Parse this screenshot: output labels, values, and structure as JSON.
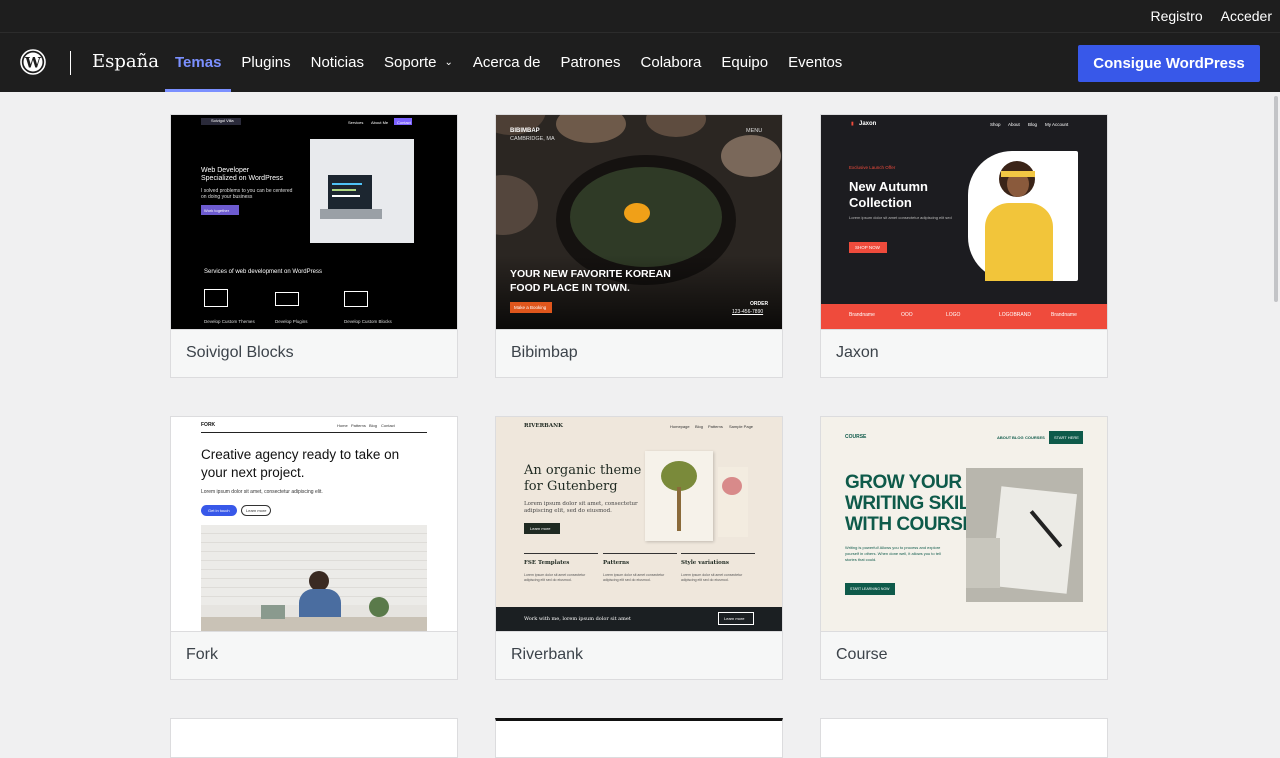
{
  "topbar": {
    "register": "Registro",
    "login": "Acceder"
  },
  "nav": {
    "locale": "España",
    "items": [
      "Temas",
      "Plugins",
      "Noticias",
      "Soporte",
      "Acerca de",
      "Patrones",
      "Colabora",
      "Equipo",
      "Eventos"
    ],
    "cta": "Consigue WordPress"
  },
  "themes": [
    {
      "name": "Soivigol Blocks",
      "preview": {
        "logo": "Soivigol Villa",
        "nav": [
          "Services",
          "About Me",
          "Contact"
        ],
        "headline1": "Web Developer",
        "headline2": "Specialized on WordPress",
        "text1": "I solved problems to you can be centered",
        "text2": "on doing your business",
        "button": "Work together",
        "section": "Services of web development on WordPress",
        "services": [
          "Develop Custom Themes",
          "Develop Plugins",
          "Develop Custom Blocks"
        ]
      }
    },
    {
      "name": "Bibimbap",
      "preview": {
        "brand": "BIBIMBAP",
        "city": "CAMBRIDGE, MA",
        "menu": "MENU",
        "headline1": "YOUR NEW FAVORITE KOREAN",
        "headline2": "FOOD PLACE IN TOWN.",
        "button": "Make a Booking",
        "order": "ORDER",
        "phone": "123-456-7890"
      }
    },
    {
      "name": "Jaxon",
      "preview": {
        "logo": "Jaxon",
        "nav": [
          "Shop",
          "About",
          "Blog",
          "My Account"
        ],
        "kicker": "Exclusive Launch Offer",
        "headline1": "New Autumn",
        "headline2": "Collection",
        "text": "Lorem ipsum dolor sit amet consectetur adipiscing elit sed",
        "button": "SHOP NOW",
        "brands": [
          "Brandname",
          "OOO",
          "LOGO",
          "LOGOBRAND",
          "Brandname"
        ]
      }
    },
    {
      "name": "Fork",
      "preview": {
        "logo": "FORK",
        "nav": [
          "Home",
          "Patterns",
          "Blog",
          "Contact"
        ],
        "headline1": "Creative agency ready to take on",
        "headline2": "your next project.",
        "text": "Lorem ipsum dolor sit amet, consectetur adipiscing elit.",
        "button1": "Get in touch",
        "button2": "Learn more"
      }
    },
    {
      "name": "Riverbank",
      "preview": {
        "logo": "RIVERBANK",
        "nav": [
          "Homepage",
          "Blog",
          "Patterns",
          "Sample Page"
        ],
        "headline1": "An organic theme",
        "headline2": "for Gutenberg",
        "text1": "Lorem ipsum dolor sit amet, consectetur",
        "text2": "adipiscing elit, sed do eiusmod.",
        "button": "Learn more",
        "cols": [
          "FSE Templates",
          "Patterns",
          "Style variations"
        ],
        "coltext": "Lorem ipsum dolor sit amet consectetur adipiscing elit sed do eiusmod.",
        "footer": "Work with me, lorem ipsum dolor sit amet",
        "footer_button": "Learn more"
      }
    },
    {
      "name": "Course",
      "preview": {
        "logo": "COURSE",
        "nav": [
          "ABOUT",
          "BLOG",
          "COURSES"
        ],
        "nav_button": "START HERE",
        "headline1": "GROW YOUR",
        "headline2": "WRITING SKILLS",
        "headline3": "WITH COURSE",
        "text": "Writing is powerful! Allows you to process and explore yourself in others. When done well, it allows you to tell stories that could.",
        "button": "START LEARNING NOW"
      }
    }
  ],
  "colors": {
    "nav_bg": "#1e1e1e",
    "accent": "#3858e9",
    "active": "#7b90ff"
  }
}
